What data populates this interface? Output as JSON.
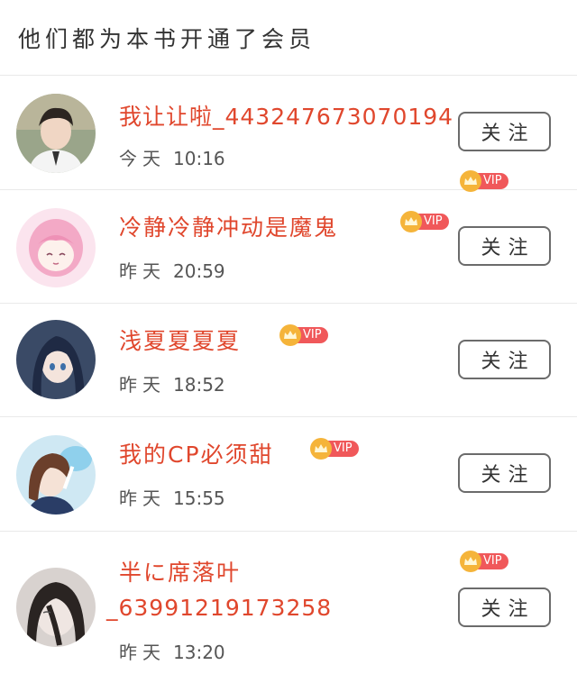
{
  "header": {
    "title": "他们都为本书开通了会员"
  },
  "vip_label": "VIP",
  "follow_label": "关注",
  "users": [
    {
      "name": "我让让啦_443247673070194",
      "day": "今天",
      "time": "10:16"
    },
    {
      "name": "冷静冷静冲动是魔鬼",
      "day": "昨天",
      "time": "20:59"
    },
    {
      "name": "浅夏夏夏夏",
      "day": "昨天",
      "time": "18:52"
    },
    {
      "name": "我的CP必须甜",
      "day": "昨天",
      "time": "15:55"
    },
    {
      "name_line1": "半に席落叶",
      "name_line2": "_63991219173258",
      "day": "昨天",
      "time": "13:20"
    }
  ],
  "colors": {
    "name": "#e0472d",
    "vip_pill": "#f0585a",
    "vip_crown": "#f5b43a",
    "divider": "#e9e9e9"
  }
}
